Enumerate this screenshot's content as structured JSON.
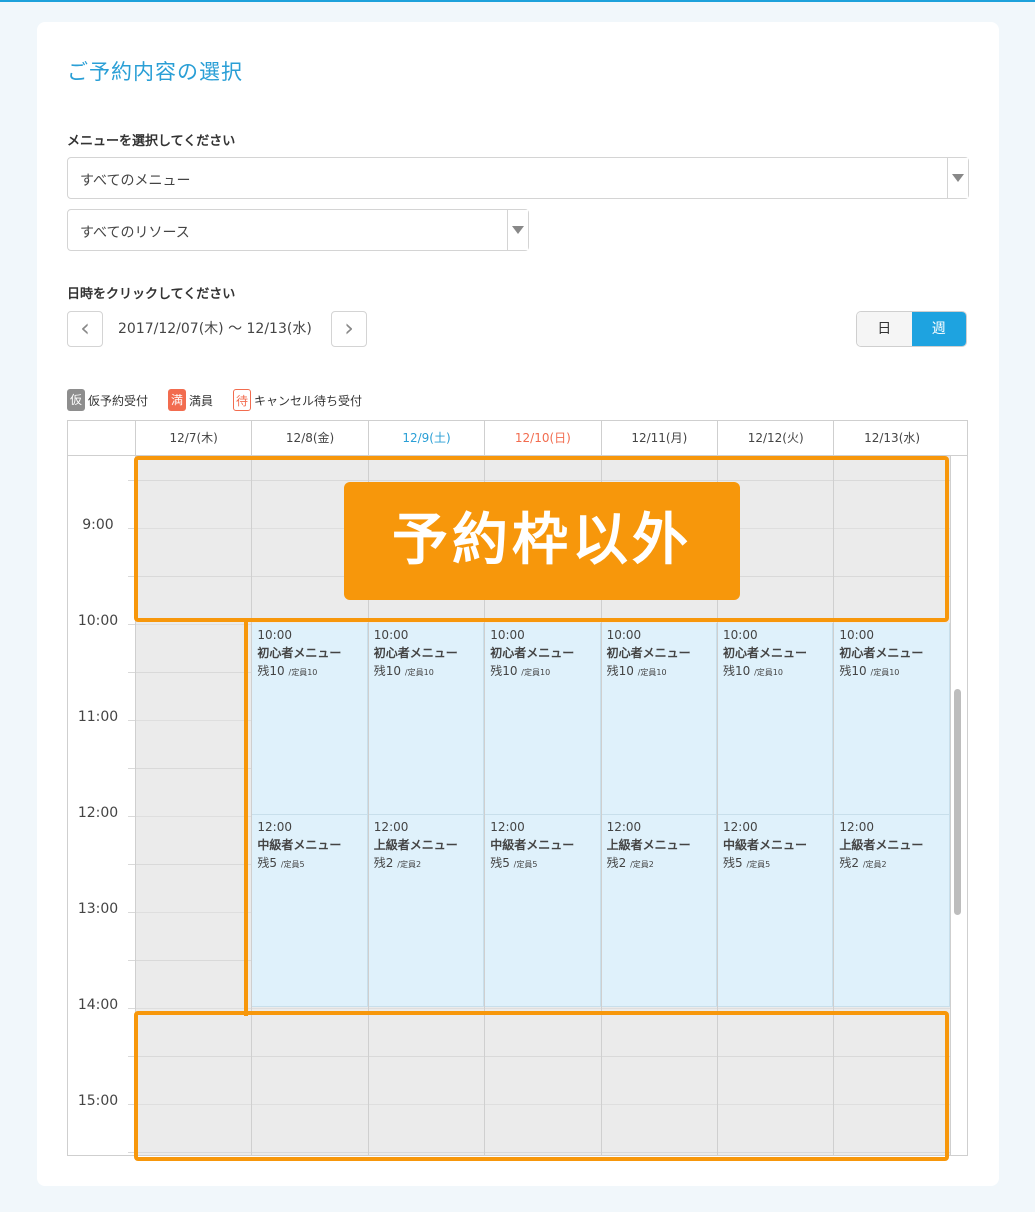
{
  "page": {
    "title": "ご予約内容の選択"
  },
  "menu_section": {
    "label": "メニューを選択してください",
    "menu_select_value": "すべてのメニュー",
    "resource_select_value": "すべてのリソース"
  },
  "date_section": {
    "label": "日時をクリックしてください",
    "range": "2017/12/07(木) ～ 12/13(水)",
    "prev_icon": "chevron-left-icon",
    "next_icon": "chevron-right-icon",
    "view_toggle": {
      "day": "日",
      "week": "週",
      "active": "week"
    }
  },
  "legend": {
    "tentative_badge": "仮",
    "tentative_label": "仮予約受付",
    "full_badge": "満",
    "full_label": "満員",
    "waitlist_badge": "待",
    "waitlist_label": "キャンセル待ち受付"
  },
  "calendar": {
    "days": [
      "12/7(木)",
      "12/8(金)",
      "12/9(土)",
      "12/10(日)",
      "12/11(月)",
      "12/12(火)",
      "12/13(水)"
    ],
    "hours": [
      "9:00",
      "10:00",
      "11:00",
      "12:00",
      "13:00",
      "14:00",
      "15:00"
    ],
    "slots": [
      {
        "time": "10:00",
        "name": "初心者メニュー",
        "remain": "残10",
        "capacity": "/定員10"
      },
      {
        "time": "10:00",
        "name": "初心者メニュー",
        "remain": "残10",
        "capacity": "/定員10"
      },
      {
        "time": "10:00",
        "name": "初心者メニュー",
        "remain": "残10",
        "capacity": "/定員10"
      },
      {
        "time": "10:00",
        "name": "初心者メニュー",
        "remain": "残10",
        "capacity": "/定員10"
      },
      {
        "time": "10:00",
        "name": "初心者メニュー",
        "remain": "残10",
        "capacity": "/定員10"
      },
      {
        "time": "10:00",
        "name": "初心者メニュー",
        "remain": "残10",
        "capacity": "/定員10"
      },
      {
        "time": "12:00",
        "name": "中級者メニュー",
        "remain": "残5",
        "capacity": "/定員5"
      },
      {
        "time": "12:00",
        "name": "上級者メニュー",
        "remain": "残2",
        "capacity": "/定員2"
      },
      {
        "time": "12:00",
        "name": "中級者メニュー",
        "remain": "残5",
        "capacity": "/定員5"
      },
      {
        "time": "12:00",
        "name": "上級者メニュー",
        "remain": "残2",
        "capacity": "/定員2"
      },
      {
        "time": "12:00",
        "name": "中級者メニュー",
        "remain": "残5",
        "capacity": "/定員5"
      },
      {
        "time": "12:00",
        "name": "上級者メニュー",
        "remain": "残2",
        "capacity": "/定員2"
      }
    ]
  },
  "annotation": {
    "label": "予約枠以外"
  },
  "colors": {
    "accent": "#1ea3e0",
    "highlight": "#f7970b",
    "saturday": "#2a9fd6",
    "sunday": "#f26c4f"
  }
}
